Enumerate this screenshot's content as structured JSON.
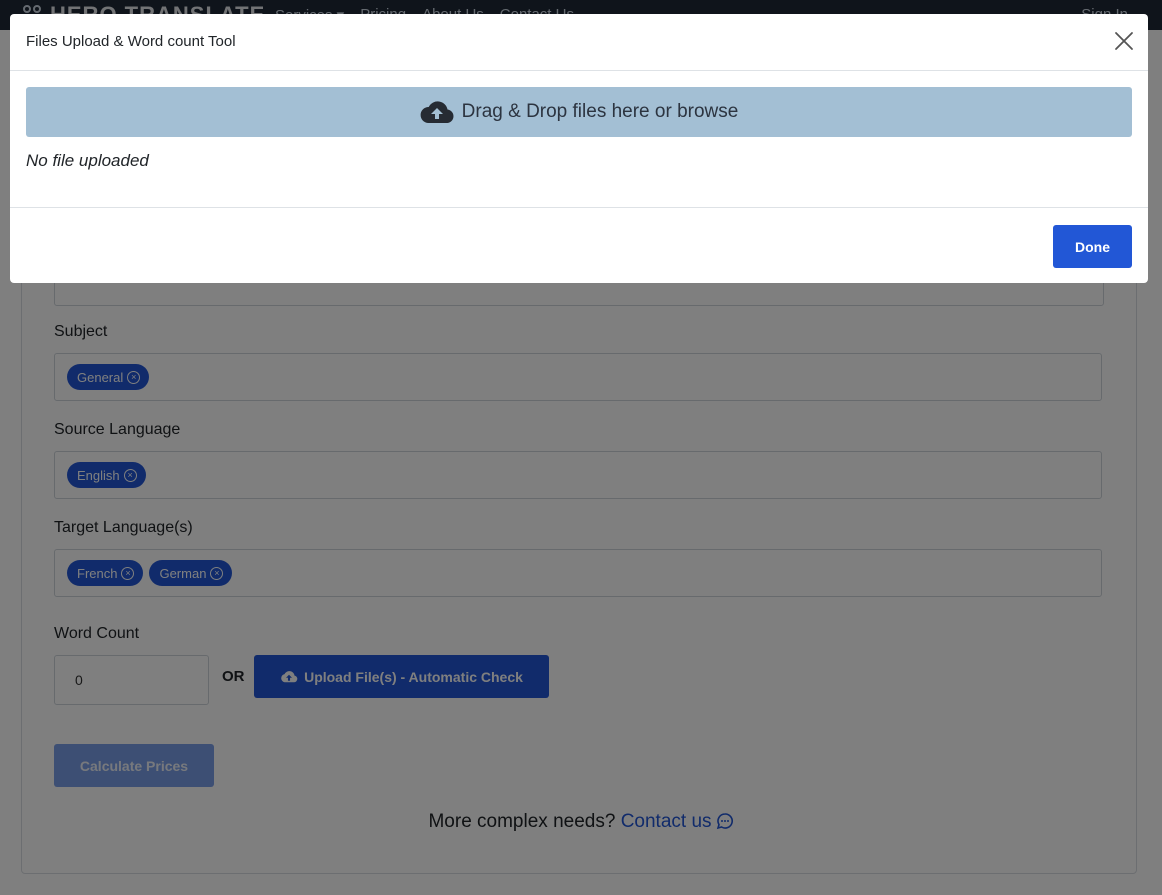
{
  "nav": {
    "logo": "HERO TRANSLATE",
    "links": [
      "Services ▾",
      "Pricing",
      "About Us",
      "Contact Us"
    ],
    "sign_in": "Sign In"
  },
  "form": {
    "subject_label": "Subject",
    "subject_tags": [
      "General"
    ],
    "source_label": "Source Language",
    "source_tags": [
      "English"
    ],
    "target_label": "Target Language(s)",
    "target_tags": [
      "French",
      "German"
    ],
    "word_count_label": "Word Count",
    "word_count_value": "0",
    "or_label": "OR",
    "upload_button": "Upload File(s) - Automatic Check",
    "calculate_button": "Calculate Prices",
    "complex_text": "More complex needs?",
    "contact_link": "Contact us"
  },
  "modal": {
    "title": "Files Upload & Word count Tool",
    "drop_zone_text": "Drag & Drop files here or browse",
    "status_text": "No file uploaded",
    "done_button": "Done"
  },
  "icons": {
    "close": "close-icon",
    "cloud_upload": "cloud-upload-icon",
    "tag_remove": "circle-x-icon",
    "chat": "chat-bubble-icon"
  },
  "colors": {
    "primary": "#2257d6",
    "drop_zone": "#a3bfd4",
    "nav_bg": "#1f2937",
    "backdrop": "rgba(0,0,0,0.5)"
  }
}
